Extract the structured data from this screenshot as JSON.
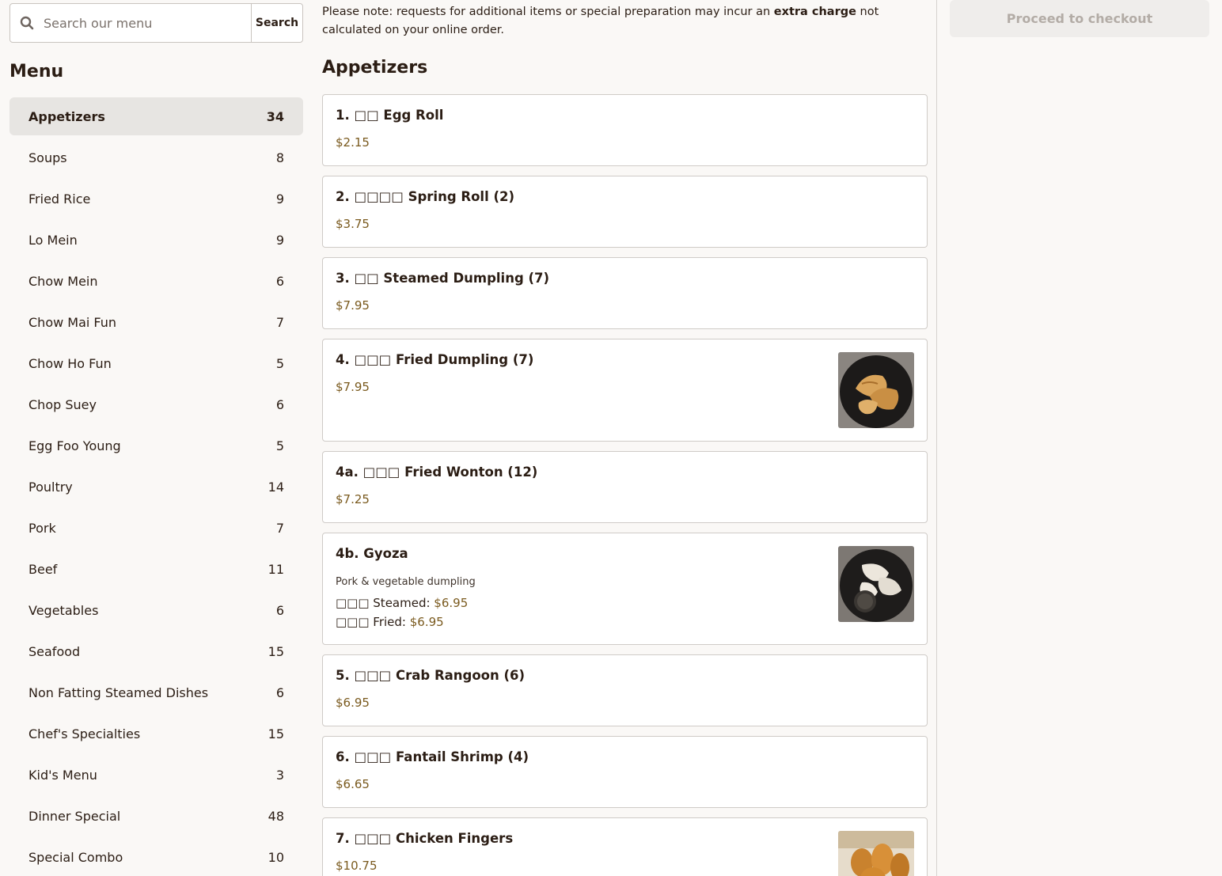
{
  "search": {
    "placeholder": "Search our menu",
    "button_label": "Search"
  },
  "sidebar": {
    "heading": "Menu",
    "categories": [
      {
        "label": "Appetizers",
        "count": "34"
      },
      {
        "label": "Soups",
        "count": "8"
      },
      {
        "label": "Fried Rice",
        "count": "9"
      },
      {
        "label": "Lo Mein",
        "count": "9"
      },
      {
        "label": "Chow Mein",
        "count": "6"
      },
      {
        "label": "Chow Mai Fun",
        "count": "7"
      },
      {
        "label": "Chow Ho Fun",
        "count": "5"
      },
      {
        "label": "Chop Suey",
        "count": "6"
      },
      {
        "label": "Egg Foo Young",
        "count": "5"
      },
      {
        "label": "Poultry",
        "count": "14"
      },
      {
        "label": "Pork",
        "count": "7"
      },
      {
        "label": "Beef",
        "count": "11"
      },
      {
        "label": "Vegetables",
        "count": "6"
      },
      {
        "label": "Seafood",
        "count": "15"
      },
      {
        "label": "Non Fatting Steamed Dishes",
        "count": "6"
      },
      {
        "label": "Chef's Specialties",
        "count": "15"
      },
      {
        "label": "Kid's Menu",
        "count": "3"
      },
      {
        "label": "Dinner Special",
        "count": "48"
      },
      {
        "label": "Special Combo",
        "count": "10"
      }
    ]
  },
  "main": {
    "notice": {
      "before": "Please note: requests for additional items or special preparation may incur an ",
      "emphasis": "extra charge",
      "after": " not calculated on your online order."
    },
    "section_title": "Appetizers",
    "items": [
      {
        "name": "1. □□ Egg Roll",
        "price": "$2.15"
      },
      {
        "name": "2. □□□□ Spring Roll (2)",
        "price": "$3.75"
      },
      {
        "name": "3. □□ Steamed Dumpling (7)",
        "price": "$7.95"
      },
      {
        "name": "4. □□□ Fried Dumpling (7)",
        "price": "$7.95",
        "image": "fried-dumpling-photo"
      },
      {
        "name": "4a. □□□ Fried Wonton (12)",
        "price": "$7.25"
      },
      {
        "name": "4b. Gyoza",
        "description": "Pork & vegetable dumpling",
        "options": [
          {
            "label": "□□□ Steamed: ",
            "price": "$6.95"
          },
          {
            "label": "□□□ Fried: ",
            "price": "$6.95"
          }
        ],
        "image": "gyoza-photo"
      },
      {
        "name": "5. □□□ Crab Rangoon (6)",
        "price": "$6.95"
      },
      {
        "name": "6. □□□ Fantail Shrimp (4)",
        "price": "$6.65"
      },
      {
        "name": "7. □□□ Chicken Fingers",
        "price": "$10.75",
        "image": "chicken-fingers-photo"
      }
    ]
  },
  "cart": {
    "checkout_label": "Proceed to checkout"
  },
  "colors": {
    "accent_price": "#7a5a1e",
    "active_category_bg": "#e7e5e2",
    "page_bg": "#faf8f6",
    "disabled_button_bg": "#efedeb",
    "disabled_button_text": "#b3aca6"
  }
}
